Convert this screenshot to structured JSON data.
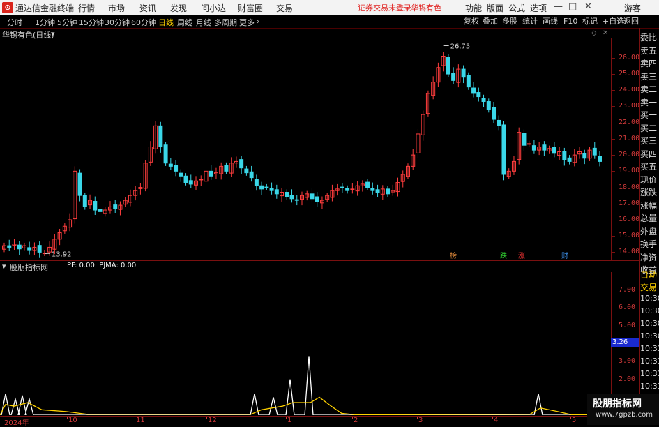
{
  "app_title": "通达信金融终端",
  "menu": [
    "行情",
    "市场",
    "资讯",
    "发现",
    "问小达",
    "财富圈",
    "交易"
  ],
  "warning": "证券交易未登录",
  "stock_menu": "华锡有色",
  "right_menu": [
    "功能",
    "版面",
    "公式",
    "选项"
  ],
  "guest": "游客",
  "periods": [
    "分时",
    "1分钟",
    "5分钟",
    "15分钟",
    "30分钟",
    "60分钟",
    "日线",
    "周线",
    "月线",
    "多周期",
    "更多"
  ],
  "active_period": "日线",
  "toolbar_buttons": [
    "复权",
    "叠加",
    "多股",
    "统计",
    "画线",
    "F10",
    "标记",
    "+自选",
    "返回"
  ],
  "main_title": "华锡有色(日线)",
  "main_y_ticks": [
    "26.00",
    "25.00",
    "24.00",
    "23.00",
    "22.00",
    "21.00",
    "20.00",
    "19.00",
    "18.00",
    "17.00",
    "16.00",
    "15.00",
    "14.00"
  ],
  "high_label": "26.75",
  "low_label": "13.92",
  "event_marks": [
    {
      "text": "榜",
      "color": "#e08a3a"
    },
    {
      "text": "跌",
      "color": "#2fc82f"
    },
    {
      "text": "涨",
      "color": "#e03030"
    },
    {
      "text": "财",
      "color": "#3a8ae0"
    }
  ],
  "sub_title": "股朋指标网",
  "sub_values": "PF: 0.00  PJMA: 0.00",
  "sub_y_ticks": [
    "7.00",
    "6.00",
    "5.00",
    "4.00",
    "3.00",
    "2.00"
  ],
  "sub_highlight": "3.26",
  "right_panel_top": [
    "委比",
    "卖五",
    "卖四",
    "卖三",
    "卖二",
    "卖一",
    "买一",
    "买二",
    "买三",
    "买四",
    "买五",
    "现价",
    "涨跌",
    "涨幅",
    "总量",
    "外盘",
    "换手",
    "净资",
    "收益"
  ],
  "right_panel_bottom": [
    "自动",
    "交易",
    "10:30",
    "10:30",
    "10:30",
    "10:30",
    "10:31",
    "10:31",
    "10:31",
    "10:31",
    "10:31",
    "10:31"
  ],
  "x_labels": [
    "2024年",
    "10",
    "11",
    "12",
    "1",
    "2",
    "3",
    "4",
    "5"
  ],
  "watermark_text": "股朋指标网",
  "watermark_url": "www.7gpzb.com",
  "chart_data": {
    "type": "candlestick",
    "ylim": [
      13.5,
      27.2
    ],
    "closes": [
      14.4,
      14.3,
      14.5,
      14.2,
      14.4,
      14.1,
      14.3,
      14.0,
      13.95,
      14.3,
      14.8,
      15.2,
      15.6,
      16.0,
      19.0,
      17.5,
      16.8,
      17.2,
      16.6,
      16.5,
      16.6,
      16.8,
      16.7,
      16.9,
      17.2,
      17.5,
      17.8,
      18.0,
      19.5,
      20.5,
      21.8,
      20.5,
      19.5,
      19.3,
      19.0,
      18.7,
      18.3,
      18.2,
      18.4,
      18.5,
      19.0,
      18.7,
      18.9,
      19.3,
      19.0,
      19.5,
      19.6,
      19.2,
      18.9,
      18.6,
      18.1,
      17.9,
      18.0,
      17.8,
      17.6,
      17.7,
      17.4,
      17.3,
      17.2,
      17.5,
      17.6,
      17.3,
      17.1,
      17.2,
      17.5,
      17.8,
      17.9,
      18.0,
      17.8,
      17.9,
      18.1,
      18.2,
      18.0,
      17.8,
      17.7,
      17.9,
      17.6,
      17.8,
      18.3,
      18.8,
      19.3,
      20.0,
      21.3,
      22.5,
      23.8,
      24.5,
      25.4,
      26.1,
      25.0,
      24.6,
      25.3,
      24.8,
      24.2,
      23.8,
      23.6,
      23.3,
      22.8,
      22.2,
      21.8,
      18.8,
      19.0,
      19.6,
      21.4,
      20.6,
      20.7,
      20.3,
      20.5,
      20.3,
      20.4,
      20.1,
      20.2,
      19.7,
      19.6,
      20.0,
      20.2,
      19.8,
      20.3,
      20.0,
      19.6
    ],
    "sub_series": [
      {
        "name": "PF",
        "color": "#ffffff"
      },
      {
        "name": "PJMA",
        "color": "#ffd200"
      }
    ]
  }
}
